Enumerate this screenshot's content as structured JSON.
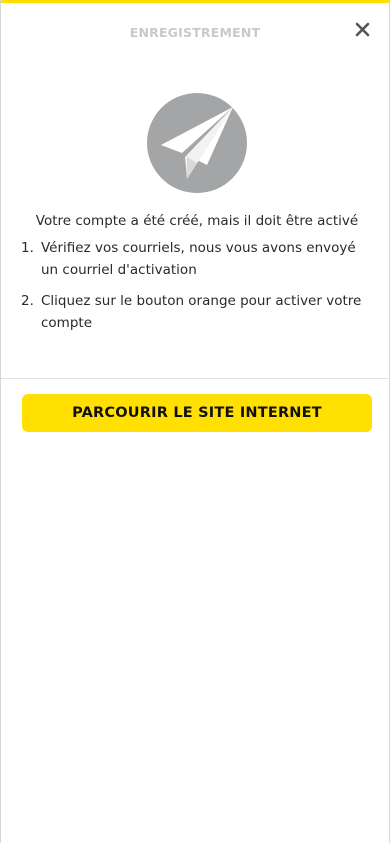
{
  "header": {
    "title": "ENREGISTREMENT",
    "close_label": "×"
  },
  "main": {
    "icon": "paper-plane-icon",
    "intro": "Votre compte a été créé, mais il doit être activé",
    "steps": [
      {
        "number": "1.",
        "text": "Vérifiez vos courriels, nous vous avons envoyé un courriel d'activation"
      },
      {
        "number": "2.",
        "text": "Cliquez sur le bouton orange pour activer votre compte"
      }
    ]
  },
  "cta": {
    "label": "PARCOURIR LE SITE INTERNET"
  },
  "colors": {
    "accent": "#ffe000",
    "icon_circle": "#a3a5a7",
    "header_text": "#c9c9c9"
  }
}
